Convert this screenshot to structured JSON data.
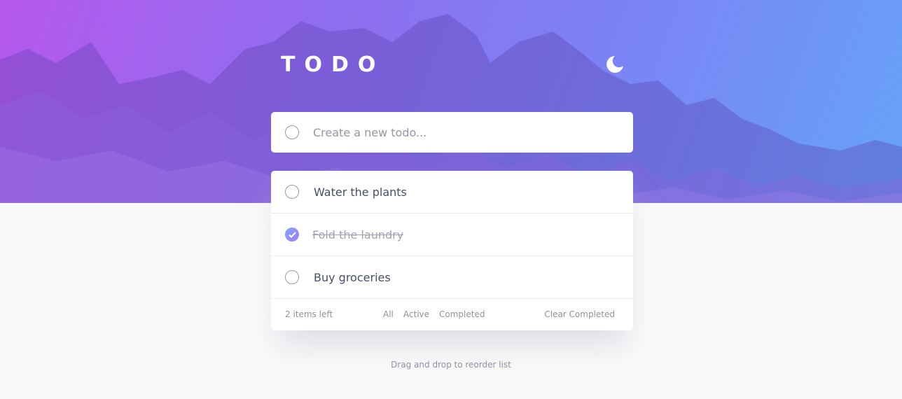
{
  "header": {
    "title": "TODO",
    "theme_icon": "moon-icon"
  },
  "new_todo": {
    "placeholder": "Create a new todo..."
  },
  "todos": [
    {
      "text": "Water the plants",
      "completed": false
    },
    {
      "text": "Fold the laundry",
      "completed": true
    },
    {
      "text": "Buy groceries",
      "completed": false
    }
  ],
  "footer": {
    "items_left": "2 items left",
    "filters": {
      "all": "All",
      "active": "Active",
      "completed": "Completed"
    },
    "clear": "Clear Completed"
  },
  "hint": "Drag and drop to reorder list",
  "colors": {
    "accent_start": "#7aa8f8",
    "accent_end": "#a878f0",
    "text": "#494c6b",
    "muted": "#9495a5"
  }
}
